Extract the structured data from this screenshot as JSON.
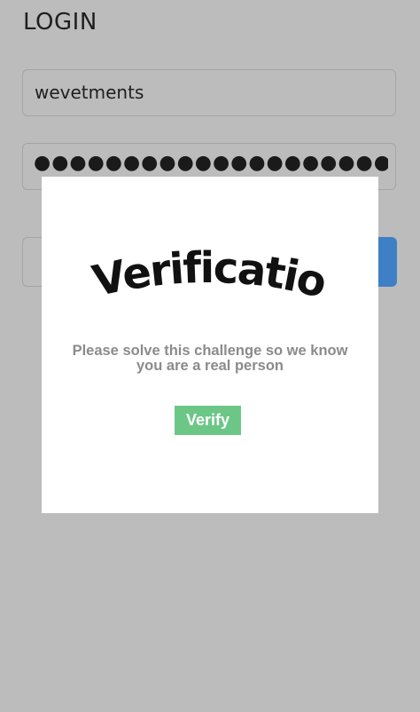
{
  "login": {
    "title": "LOGIN",
    "username_value": "wevetments",
    "password_mask": "●●●●●●●●●●●●●●●●●●●●●●●●●"
  },
  "modal": {
    "logo_text": "Verification",
    "message": "Please solve this challenge so we know you are a real person",
    "verify_label": "Verify"
  },
  "colors": {
    "backdrop": "#bcbcbc",
    "primary_button": "#3f7fc6",
    "verify_button": "#6cc786",
    "message_text": "#8b8b8b"
  }
}
